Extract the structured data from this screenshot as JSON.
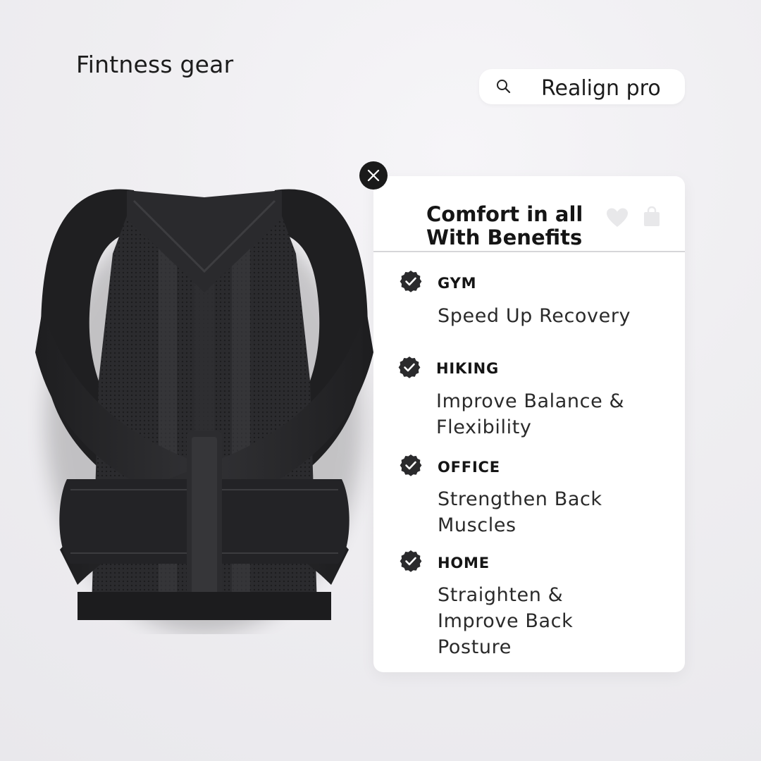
{
  "header": {
    "brand": "Fintness gear"
  },
  "search": {
    "value": "Realign pro",
    "icon": "search-icon"
  },
  "product": {
    "icon": "posture-corrector-brace"
  },
  "card": {
    "title_line1": "Comfort in all",
    "title_line2": "With Benefits",
    "icons": [
      "heart-icon",
      "shopping-bag-icon",
      "close-icon"
    ],
    "benefits": [
      {
        "label": "GYM",
        "description": "Speed Up Recovery"
      },
      {
        "label": "HIKING",
        "description": "Improve Balance & Flexibility"
      },
      {
        "label": "OFFICE",
        "description": "Strengthen Back Muscles"
      },
      {
        "label": "HOME",
        "description": "Straighten & Improve Back Posture"
      }
    ]
  },
  "colors": {
    "background": "#efeef1",
    "card": "#ffffff",
    "accent_dark": "#1a1a1a",
    "icon_muted": "#e6e6e8"
  }
}
